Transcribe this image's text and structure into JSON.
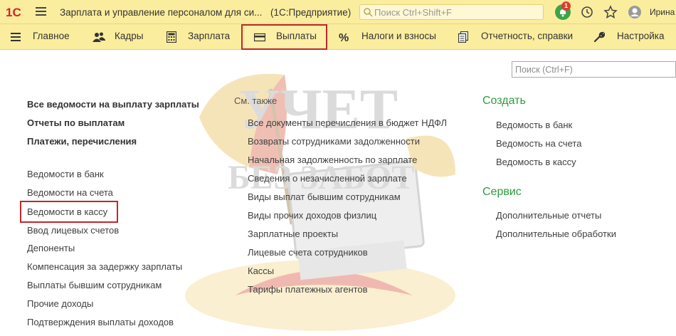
{
  "titlebar": {
    "logo": "1С",
    "app_title": "Зарплата и управление персоналом для си...",
    "platform": "(1С:Предприятие)",
    "search_placeholder": "Поиск Ctrl+Shift+F",
    "notifications_count": "1",
    "user_name": "Ирина Б"
  },
  "sections": [
    {
      "label": "Главное",
      "icon": "list-icon"
    },
    {
      "label": "Кадры",
      "icon": "people-icon"
    },
    {
      "label": "Зарплата",
      "icon": "calculator-icon"
    },
    {
      "label": "Выплаты",
      "icon": "wallet-icon",
      "active": true
    },
    {
      "label": "Налоги и взносы",
      "icon": "percent-icon"
    },
    {
      "label": "Отчетность, справки",
      "icon": "reports-icon"
    },
    {
      "label": "Настройка",
      "icon": "wrench-icon"
    }
  ],
  "search_main": {
    "placeholder": "Поиск (Ctrl+F)"
  },
  "watermark": {
    "line1": "УЧЕТ",
    "line2": "БЕЗ ЗАБОТ"
  },
  "left_column": {
    "important": [
      "Все ведомости на выплату зарплаты",
      "Отчеты по выплатам",
      "Платежи, перечисления"
    ],
    "items": [
      "Ведомости в банк",
      "Ведомости на счета",
      "Ведомости в кассу",
      "Ввод лицевых счетов",
      "Депоненты",
      "Компенсация за задержку зарплаты",
      "Выплаты бывшим сотрудникам",
      "Прочие доходы",
      "Подтверждения выплаты доходов"
    ]
  },
  "middle_column": {
    "header": "См. также",
    "items": [
      "Все документы перечисления в бюджет НДФЛ",
      "Возвраты сотрудниками задолженности",
      "Начальная задолженность по зарплате",
      "Сведения о незачисленной зарплате",
      "Виды выплат бывшим сотрудникам",
      "Виды прочих доходов физлиц",
      "Зарплатные проекты",
      "Лицевые счета сотрудников",
      "Кассы",
      "Тарифы платежных агентов"
    ]
  },
  "right_column": {
    "create_title": "Создать",
    "create_items": [
      "Ведомость в банк",
      "Ведомость на счета",
      "Ведомость в кассу"
    ],
    "service_title": "Сервис",
    "service_items": [
      "Дополнительные отчеты",
      "Дополнительные обработки"
    ]
  },
  "colors": {
    "bar": "#fbed9e",
    "highlight": "#c0272d",
    "group_title": "#2d9b3f"
  }
}
